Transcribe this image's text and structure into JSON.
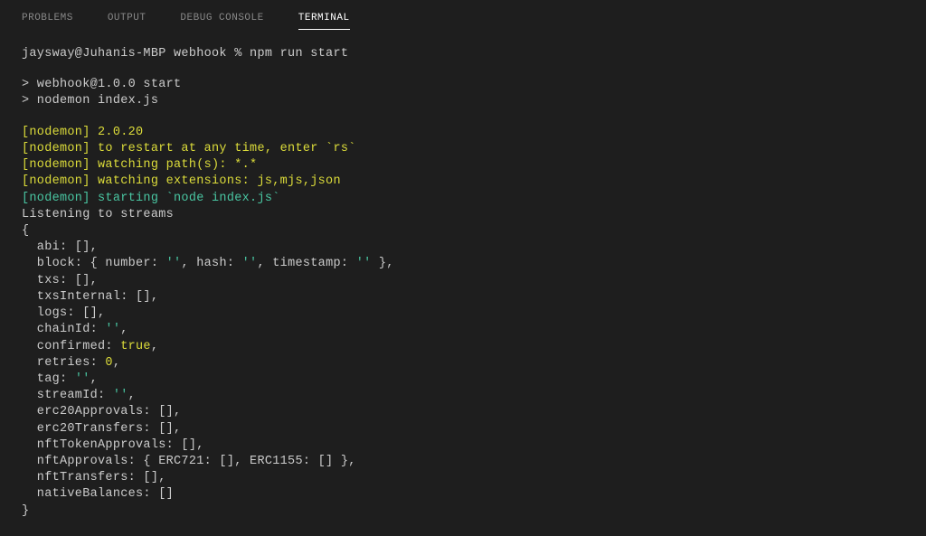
{
  "tabs": {
    "problems": "PROBLEMS",
    "output": "OUTPUT",
    "debug_console": "DEBUG CONSOLE",
    "terminal": "TERMINAL"
  },
  "terminal": {
    "prompt": "jaysway@Juhanis-MBP webhook % npm run start",
    "run_line1": "> webhook@1.0.0 start",
    "run_line2": "> nodemon index.js",
    "nodemon": {
      "version": "[nodemon] 2.0.20",
      "restart": "[nodemon] to restart at any time, enter `rs`",
      "watching_paths": "[nodemon] watching path(s): *.*",
      "watching_ext": "[nodemon] watching extensions: js,mjs,json",
      "starting": "[nodemon] starting `node index.js`"
    },
    "listening": "Listening to streams",
    "obj": {
      "open": "{",
      "abi": "  abi: [],",
      "block_pre": "  block: { number: ",
      "block_q1": "''",
      "block_hash": ", hash: ",
      "block_q2": "''",
      "block_ts": ", timestamp: ",
      "block_q3": "''",
      "block_end": " },",
      "txs": "  txs: [],",
      "txsInternal": "  txsInternal: [],",
      "logs": "  logs: [],",
      "chainId_pre": "  chainId: ",
      "chainId_q": "''",
      "chainId_end": ",",
      "confirmed_pre": "  confirmed: ",
      "confirmed_val": "true",
      "confirmed_end": ",",
      "retries_pre": "  retries: ",
      "retries_val": "0",
      "retries_end": ",",
      "tag_pre": "  tag: ",
      "tag_q": "''",
      "tag_end": ",",
      "streamId_pre": "  streamId: ",
      "streamId_q": "''",
      "streamId_end": ",",
      "erc20Approvals": "  erc20Approvals: [],",
      "erc20Transfers": "  erc20Transfers: [],",
      "nftTokenApprovals": "  nftTokenApprovals: [],",
      "nftApprovals": "  nftApprovals: { ERC721: [], ERC1155: [] },",
      "nftTransfers": "  nftTransfers: [],",
      "nativeBalances": "  nativeBalances: []",
      "close": "}"
    }
  }
}
